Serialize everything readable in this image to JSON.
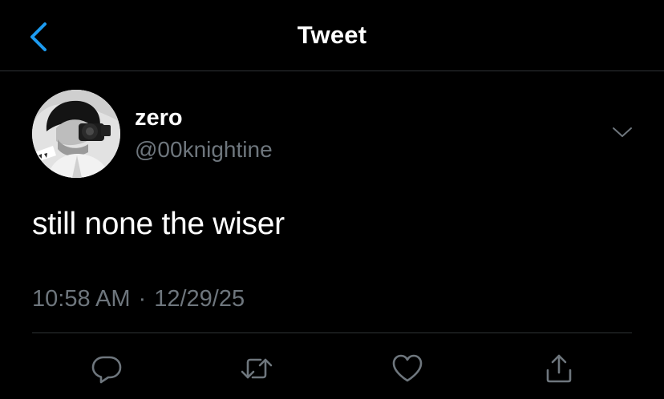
{
  "header": {
    "back_icon": "chevron-left-icon",
    "title": "Tweet"
  },
  "author": {
    "display_name": "zero",
    "handle": "@00knightine"
  },
  "tweet": {
    "text": "still none the wiser",
    "time": "10:58 AM",
    "separator": "·",
    "date": "12/29/25"
  },
  "actions": [
    {
      "icon": "reply-icon"
    },
    {
      "icon": "retweet-icon"
    },
    {
      "icon": "like-icon"
    },
    {
      "icon": "share-icon"
    }
  ],
  "colors": {
    "background": "#000000",
    "accent": "#1d9bf0",
    "primary_text": "#ffffff",
    "secondary_text": "#6e767d",
    "divider": "#2f3336"
  }
}
